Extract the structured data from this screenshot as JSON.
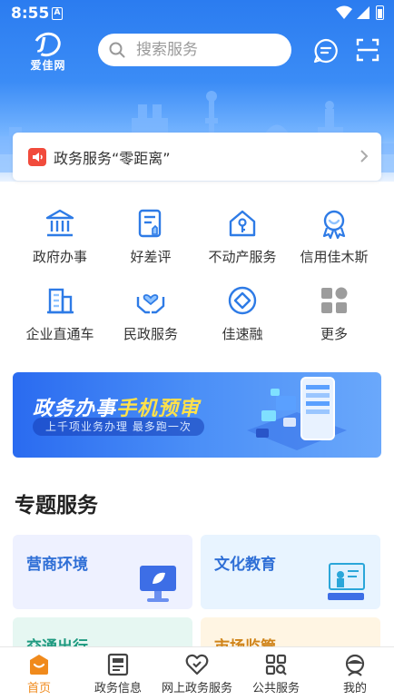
{
  "status_bar": {
    "time": "8:55",
    "indicator": "A"
  },
  "header": {
    "logo_text": "爱佳网",
    "search_placeholder": "搜索服务",
    "icons": [
      "message-icon",
      "scan-icon"
    ]
  },
  "notice": {
    "text": "政务服务“零距离”"
  },
  "services": [
    {
      "label": "政府办事",
      "icon": "government-building-icon"
    },
    {
      "label": "好差评",
      "icon": "rating-document-icon"
    },
    {
      "label": "不动产服务",
      "icon": "house-key-icon"
    },
    {
      "label": "信用佳木斯",
      "icon": "credit-badge-icon"
    },
    {
      "label": "企业直通车",
      "icon": "enterprise-building-icon"
    },
    {
      "label": "民政服务",
      "icon": "care-hands-icon"
    },
    {
      "label": "佳速融",
      "icon": "diamond-circle-icon"
    },
    {
      "label": "更多",
      "icon": "more-grid-icon"
    }
  ],
  "banner": {
    "title_part1": "政务办事",
    "title_part2": "手机预审",
    "subtitle": "上千项业务办理 最多跑一次"
  },
  "topics": {
    "title": "专题服务",
    "items": [
      {
        "label": "营商环境",
        "color": "#2f6fd6",
        "bg": "#eef1ff"
      },
      {
        "label": "文化教育",
        "color": "#2f6fd6",
        "bg": "#e8f4ff"
      },
      {
        "label": "交通出行",
        "color": "#1f9a80",
        "bg": "#e6f7f2"
      },
      {
        "label": "市场监管",
        "color": "#d0841a",
        "bg": "#fff5e3"
      }
    ]
  },
  "bottom_nav": [
    {
      "label": "首页",
      "icon": "home-icon",
      "active": true
    },
    {
      "label": "政务信息",
      "icon": "news-icon",
      "active": false
    },
    {
      "label": "网上政务服务",
      "icon": "heart-check-icon",
      "active": false
    },
    {
      "label": "公共服务",
      "icon": "grid-search-icon",
      "active": false
    },
    {
      "label": "我的",
      "icon": "profile-icon",
      "active": false
    }
  ],
  "colors": {
    "primary": "#2b7cf0",
    "accent": "#f08a1c",
    "notice_red": "#f14b3c",
    "icon_blue": "#2e7be6"
  }
}
